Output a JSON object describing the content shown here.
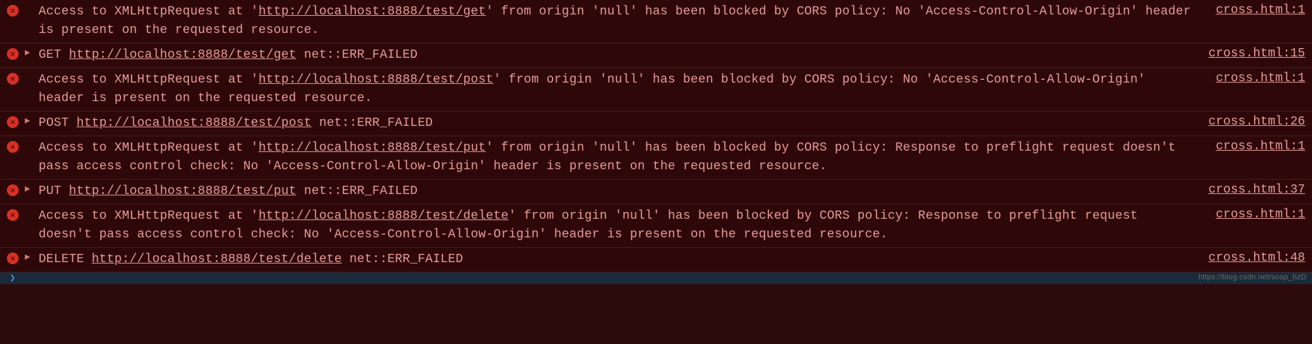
{
  "watermark": "https://blog.csdn.net/soap_hzD",
  "entries": [
    {
      "type": "cors",
      "icon": "error",
      "disclosure": false,
      "pre1": "Access to XMLHttpRequest at '",
      "url": "http://localhost:8888/test/get",
      "mid": "' from origin '",
      "origin": "null",
      "post": "' has been blocked by CORS policy: No 'Access-Control-Allow-Origin' header is present on the requested resource.",
      "source": "cross.html:1"
    },
    {
      "type": "net",
      "icon": "error",
      "disclosure": true,
      "method": "GET ",
      "url": "http://localhost:8888/test/get",
      "suffix": " net::ERR_FAILED",
      "source": "cross.html:15"
    },
    {
      "type": "cors",
      "icon": "error",
      "disclosure": false,
      "pre1": "Access to XMLHttpRequest at '",
      "url": "http://localhost:8888/test/post",
      "mid": "' from origin '",
      "origin": "null",
      "post": "' has been blocked by CORS policy: No 'Access-Control-Allow-Origin' header is present on the requested resource.",
      "source": "cross.html:1"
    },
    {
      "type": "net",
      "icon": "error",
      "disclosure": true,
      "method": "POST ",
      "url": "http://localhost:8888/test/post",
      "suffix": " net::ERR_FAILED",
      "source": "cross.html:26"
    },
    {
      "type": "cors",
      "icon": "error",
      "disclosure": false,
      "pre1": "Access to XMLHttpRequest at '",
      "url": "http://localhost:8888/test/put",
      "mid": "' from origin '",
      "origin": "null",
      "post": "' has been blocked by CORS policy: Response to preflight request doesn't pass access control check: No 'Access-Control-Allow-Origin' header is present on the requested resource.",
      "source": "cross.html:1"
    },
    {
      "type": "net",
      "icon": "error",
      "disclosure": true,
      "method": "PUT ",
      "url": "http://localhost:8888/test/put",
      "suffix": " net::ERR_FAILED",
      "source": "cross.html:37"
    },
    {
      "type": "cors",
      "icon": "error",
      "disclosure": false,
      "pre1": "Access to XMLHttpRequest at '",
      "url": "http://localhost:8888/test/delete",
      "mid": "' from origin '",
      "origin": "null",
      "post": "' has been blocked by CORS policy: Response to preflight request doesn't pass access control check: No 'Access-Control-Allow-Origin' header is present on the requested resource.",
      "source": "cross.html:1"
    },
    {
      "type": "net",
      "icon": "error",
      "disclosure": true,
      "method": "DELETE ",
      "url": "http://localhost:8888/test/delete",
      "suffix": " net::ERR_FAILED",
      "source": "cross.html:48"
    }
  ]
}
